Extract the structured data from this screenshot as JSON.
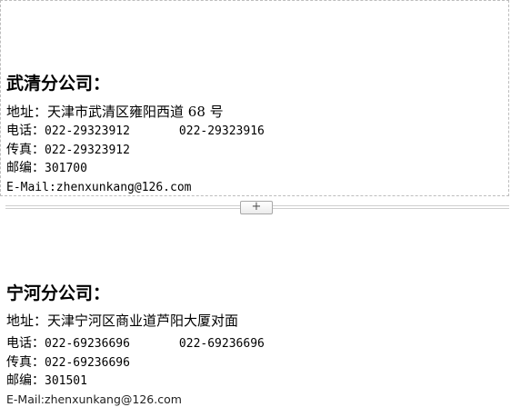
{
  "editor": {
    "expand_button_label": "+"
  },
  "wuqing": {
    "heading": "武清分公司：",
    "address_label": "地址：",
    "address": "天津市武清区雍阳西道 68 号",
    "phone_label": "电话：",
    "phone_1": "022-29323912",
    "phone_2": "022-29323916",
    "fax_label": "传真：",
    "fax": "022-29323912",
    "postcode_label": "邮编：",
    "postcode": "301700",
    "email_text": "E-Mail:zhenxunkang@126.com"
  },
  "ninghe": {
    "heading": "宁河分公司：",
    "address_label": "地址：",
    "address": "天津宁河区商业道芦阳大厦对面",
    "phone_label": "电话：",
    "phone_1": "022-69236696",
    "phone_2": "022-69236696",
    "fax_label": "传真：",
    "fax": "022-69236696",
    "postcode_label": "邮编：",
    "postcode": "301501",
    "email_text": "E-Mail:zhenxunkang@126.com"
  }
}
